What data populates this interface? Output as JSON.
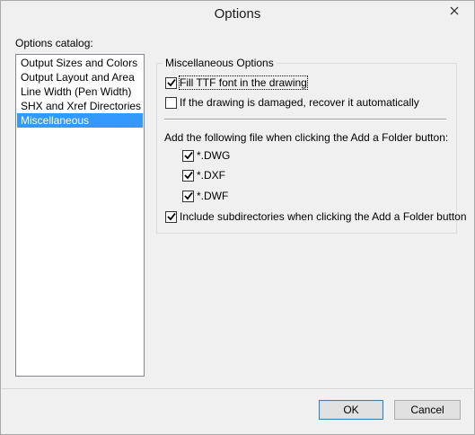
{
  "window": {
    "title": "Options"
  },
  "catalog": {
    "label": "Options catalog:",
    "items": [
      "Output Sizes and Colors",
      "Output Layout and Area",
      "Line Width (Pen Width)",
      "SHX and Xref Directories",
      "Miscellaneous"
    ],
    "selected_index": 4
  },
  "misc": {
    "group_title": "Miscellaneous Options",
    "fill_ttf": {
      "label": "Fill TTF font in the drawing",
      "checked": true
    },
    "recover": {
      "label": "If the drawing is damaged, recover it automatically",
      "checked": false
    },
    "add_label": "Add the following file when clicking the Add a Folder button:",
    "dwg": {
      "label": "*.DWG",
      "checked": true
    },
    "dxf": {
      "label": "*.DXF",
      "checked": true
    },
    "dwf": {
      "label": "*.DWF",
      "checked": true
    },
    "subdirs": {
      "label": "Include subdirectories when clicking the Add a Folder button",
      "checked": true
    }
  },
  "buttons": {
    "ok": "OK",
    "cancel": "Cancel"
  },
  "icons": {
    "close": "close-icon",
    "check": "checkmark-icon"
  }
}
